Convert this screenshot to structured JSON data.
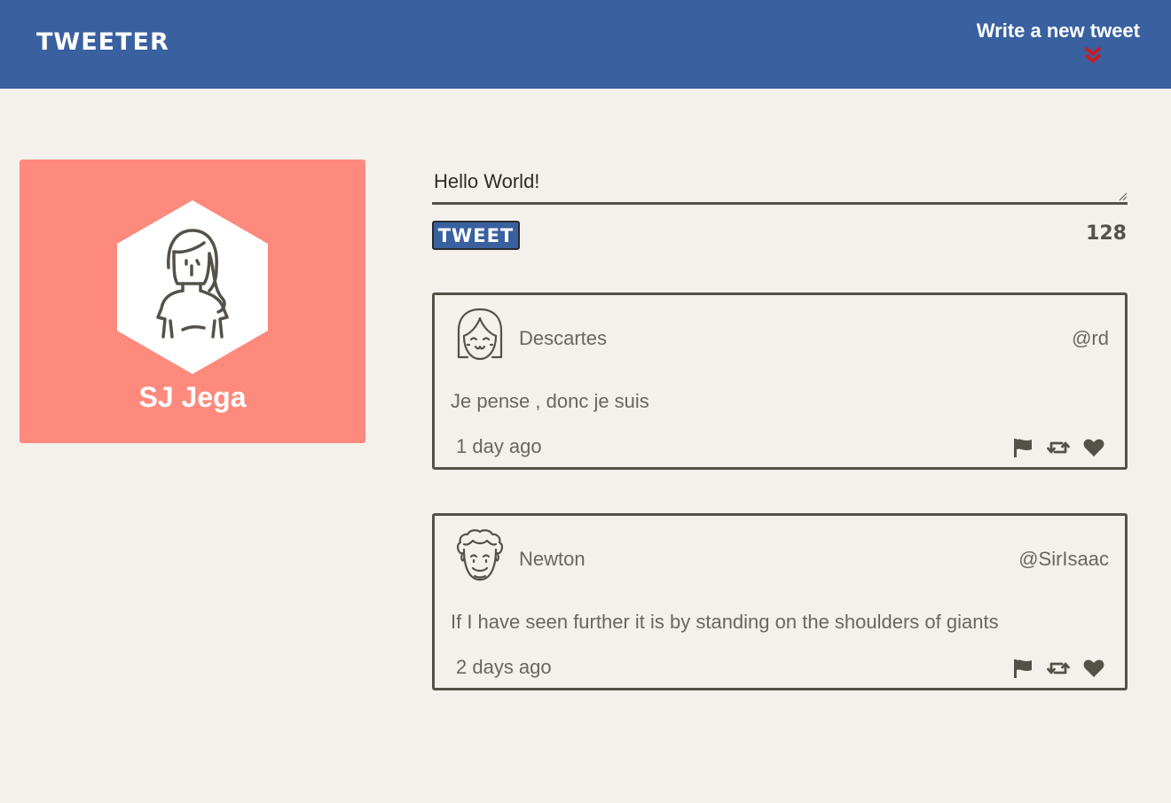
{
  "nav": {
    "logo": "TWEETER",
    "compose_label": "Write a new tweet",
    "arrow_icon": "double-chevron-down-icon",
    "arrow_color": "#d0191b",
    "background": "#39609f"
  },
  "profile": {
    "name": "SJ Jega",
    "avatar_icon": "female-user-avatar-icon",
    "card_color": "#fd8a7c"
  },
  "compose": {
    "text": "Hello World!",
    "button_label": "TWEET",
    "remaining_chars": "128"
  },
  "tweets": [
    {
      "author": "Descartes",
      "handle": "@rd",
      "content": "Je pense , donc je suis",
      "time": "1 day ago",
      "avatar_icon": "smiling-girl-avatar-icon",
      "actions": [
        "flag-icon",
        "retweet-icon",
        "heart-icon"
      ]
    },
    {
      "author": "Newton",
      "handle": "@SirIsaac",
      "content": "If I have seen further it is by standing on the shoulders of giants",
      "time": "2 days ago",
      "avatar_icon": "curly-hair-man-avatar-icon",
      "actions": [
        "flag-icon",
        "retweet-icon",
        "heart-icon"
      ]
    }
  ],
  "colors": {
    "page_background": "#f4f1ec",
    "text_dark": "#545149",
    "accent_blue": "#39609f"
  }
}
